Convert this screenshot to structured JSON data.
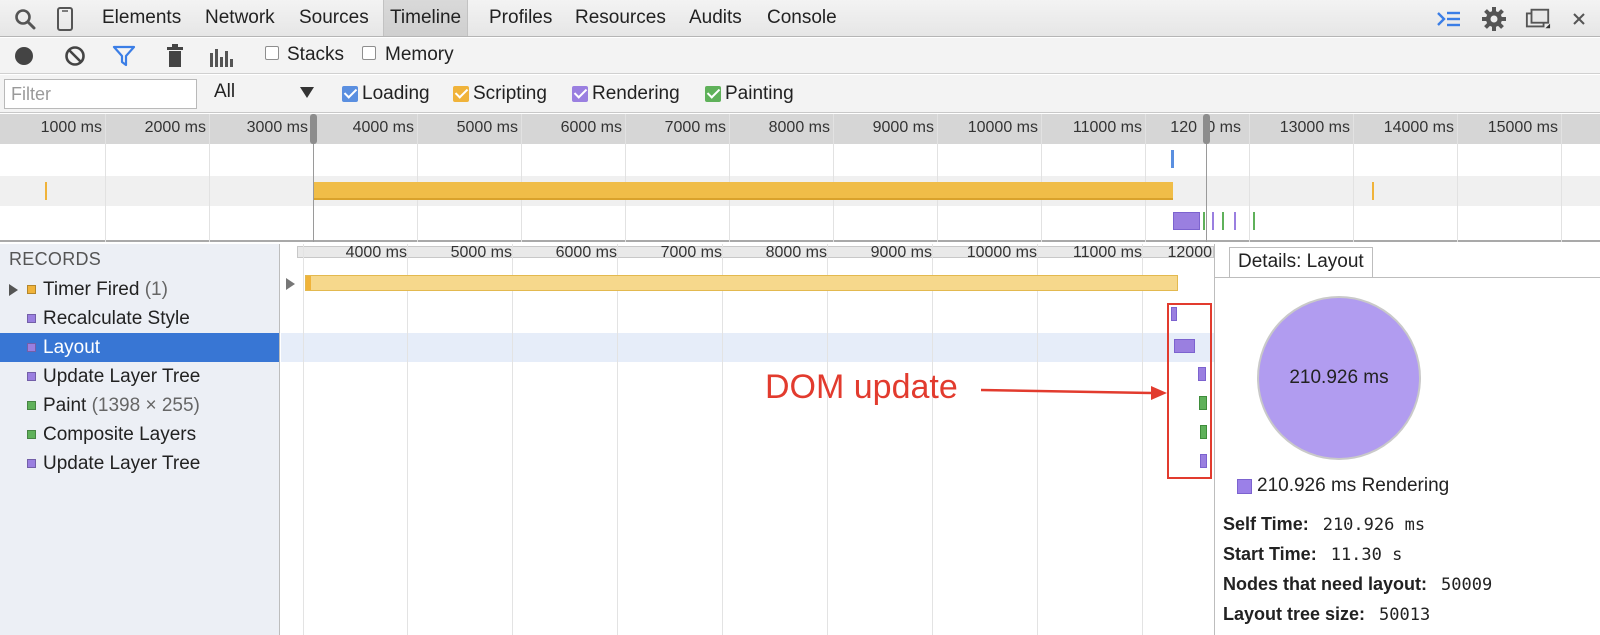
{
  "tabbar": {
    "tabs": [
      {
        "label": "Elements"
      },
      {
        "label": "Network"
      },
      {
        "label": "Sources"
      },
      {
        "label": "Timeline"
      },
      {
        "label": "Profiles"
      },
      {
        "label": "Resources"
      },
      {
        "label": "Audits"
      },
      {
        "label": "Console"
      }
    ],
    "active_tab": "Timeline",
    "icons": [
      "search-icon",
      "device-icon",
      "console-drawer-icon",
      "gear-icon",
      "dock-icon",
      "close-icon"
    ]
  },
  "toolbar": {
    "stacks_label": "Stacks",
    "memory_label": "Memory",
    "stacks_checked": false,
    "memory_checked": false
  },
  "filterbar": {
    "placeholder": "Filter",
    "select_value": "All",
    "categories": [
      {
        "label": "Loading",
        "color": "#5a8fe0",
        "checked": true
      },
      {
        "label": "Scripting",
        "color": "#f0b33a",
        "checked": true
      },
      {
        "label": "Rendering",
        "color": "#9a7fe0",
        "checked": true
      },
      {
        "label": "Painting",
        "color": "#5fb15a",
        "checked": true
      }
    ]
  },
  "overview": {
    "labels": [
      "1000 ms",
      "2000 ms",
      "3000 ms",
      "4000 ms",
      "5000 ms",
      "6000 ms",
      "7000 ms",
      "8000 ms",
      "9000 ms",
      "10000 ms",
      "11000 ms",
      "120",
      "0 ms",
      "13000 ms",
      "14000 ms",
      "15000 ms"
    ]
  },
  "records": {
    "title": "RECORDS",
    "items": [
      {
        "label": "Timer Fired",
        "suffix": "(1)",
        "color": "#f0b33a"
      },
      {
        "label": "Recalculate Style",
        "suffix": "",
        "color": "#9a7fe0"
      },
      {
        "label": "Layout",
        "suffix": "",
        "color": "#9a7fe0"
      },
      {
        "label": "Update Layer Tree",
        "suffix": "",
        "color": "#9a7fe0"
      },
      {
        "label": "Paint",
        "suffix": "(1398 × 255)",
        "color": "#5fb15a"
      },
      {
        "label": "Composite Layers",
        "suffix": "",
        "color": "#5fb15a"
      },
      {
        "label": "Update Layer Tree",
        "suffix": "",
        "color": "#9a7fe0"
      }
    ],
    "selected_index": 2
  },
  "main": {
    "labels": [
      "4000 ms",
      "5000 ms",
      "6000 ms",
      "7000 ms",
      "8000 ms",
      "9000 ms",
      "10000 ms",
      "11000 ms",
      "12000"
    ],
    "annotation": "DOM update"
  },
  "details": {
    "tab_label": "Details: Layout",
    "pie_label": "210.926 ms",
    "legend": "210.926 ms Rendering",
    "rows": [
      {
        "key": "Self Time:",
        "value": "210.926 ms"
      },
      {
        "key": "Start Time:",
        "value": "11.30 s"
      },
      {
        "key": "Nodes that need layout:",
        "value": "50009"
      },
      {
        "key": "Layout tree size:",
        "value": "50013"
      }
    ]
  }
}
